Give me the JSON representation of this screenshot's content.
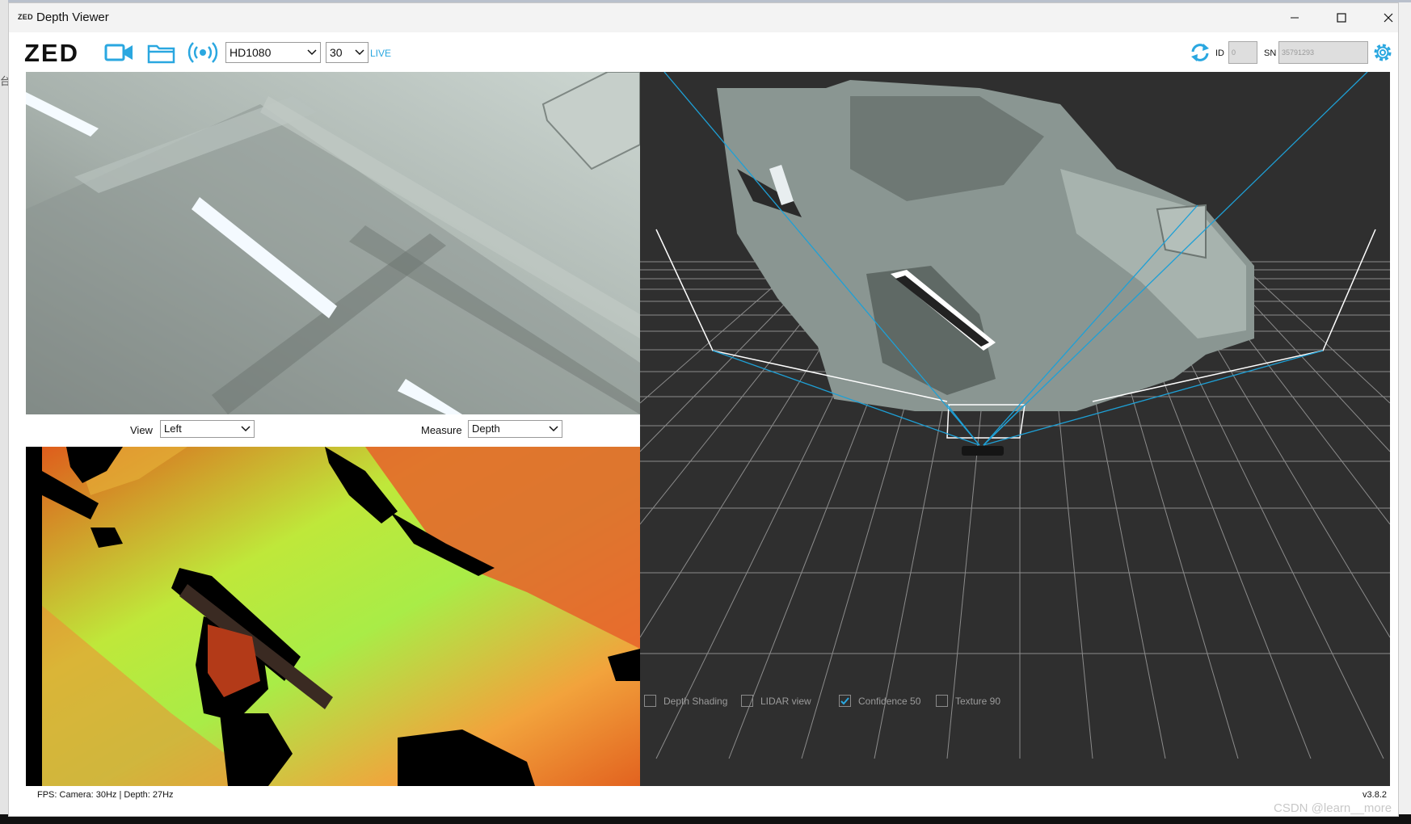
{
  "window": {
    "title": "Depth Viewer",
    "title_logo": "ZED"
  },
  "toolbar": {
    "logo": "ZED",
    "resolution": "HD1080",
    "fps": "30",
    "live": "LIVE",
    "id_label": "ID",
    "id_value": "0",
    "sn_label": "SN",
    "sn_value": "35791293",
    "icons": [
      "video-camera-icon",
      "folder-icon",
      "stream-icon",
      "refresh-icon",
      "settings-gear-icon"
    ]
  },
  "controls": {
    "view_label": "View",
    "view_value": "Left",
    "measure_label": "Measure",
    "measure_value": "Depth"
  },
  "cloud_options": [
    {
      "label": "Depth Shading",
      "checked": false
    },
    {
      "label": "LIDAR view",
      "checked": false
    },
    {
      "label": "Confidence 50",
      "checked": true
    },
    {
      "label": "Texture 90",
      "checked": false
    }
  ],
  "status": {
    "fps_text": "FPS: Camera: 30Hz | Depth: 27Hz",
    "version": "v3.8.2"
  },
  "desktop": {
    "left_edge_text": "台",
    "watermark": "CSDN @learn__more"
  },
  "colors": {
    "accent": "#2aa7e0",
    "cloud_bg": "#2f2f2f",
    "frustum": "#1ea0d6"
  }
}
